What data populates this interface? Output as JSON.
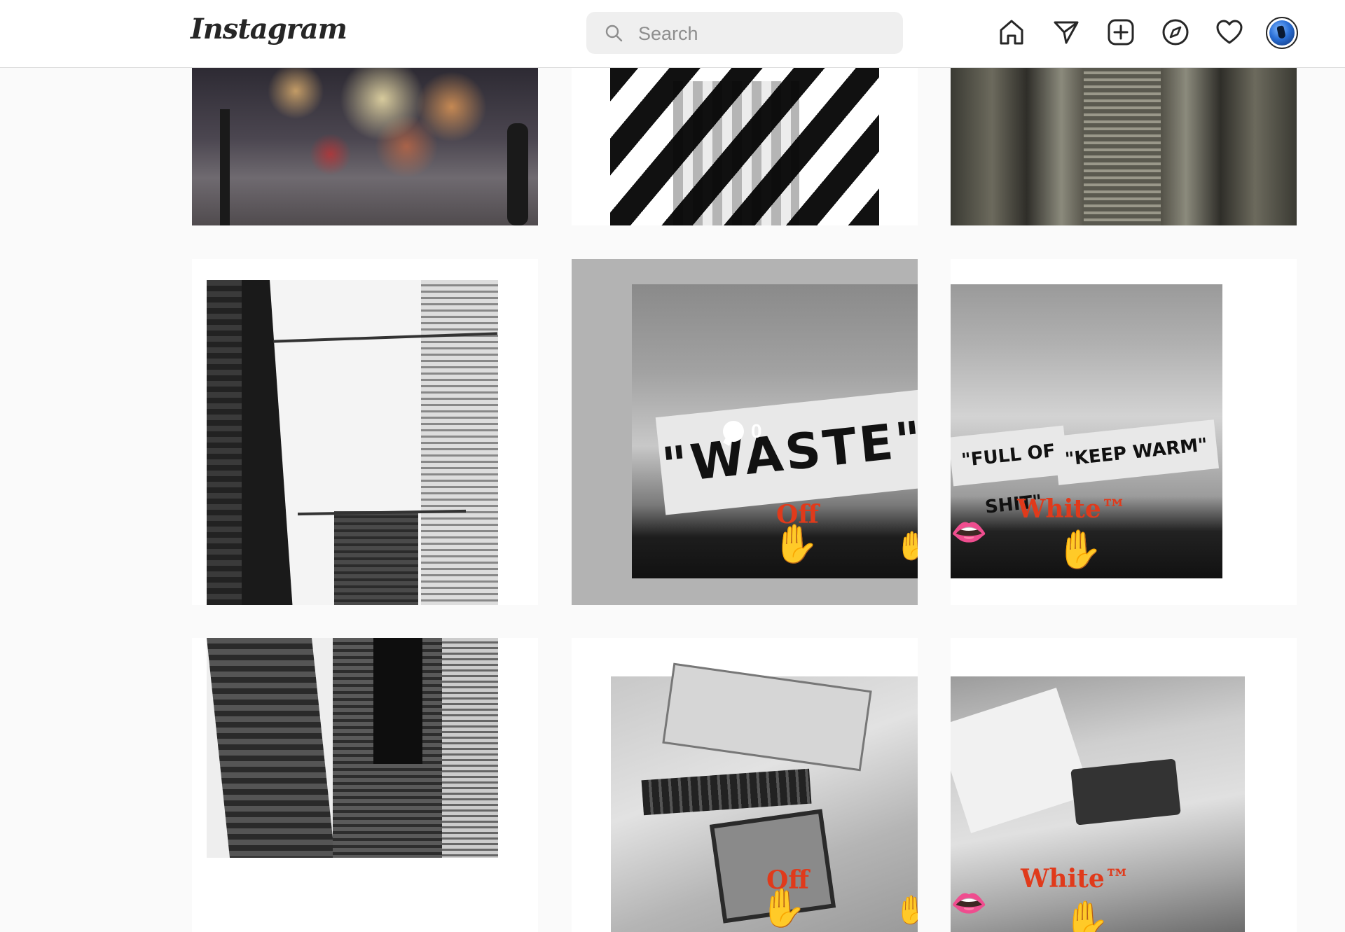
{
  "header": {
    "logo": "Instagram",
    "search_placeholder": "Search",
    "nav_icons": [
      "home-icon",
      "direct-icon",
      "new-post-icon",
      "explore-icon",
      "activity-icon",
      "avatar"
    ]
  },
  "grid": {
    "posts": [
      {
        "id": 1,
        "brand_left": "",
        "brand_right": ""
      },
      {
        "id": 2,
        "brand_left": "",
        "brand_right": ""
      },
      {
        "id": 3,
        "brand_left": "",
        "brand_right": ""
      },
      {
        "id": 4,
        "brand_left": "",
        "brand_right": ""
      },
      {
        "id": 5,
        "sign_text": "\"WASTE\"",
        "brand_text": "Off",
        "comments": "0"
      },
      {
        "id": 6,
        "sign_text_1": "\"FULL OF SHIT\"",
        "sign_text_2": "\"KEEP WARM\"",
        "brand_text": "White™"
      },
      {
        "id": 7,
        "brand_left": "",
        "brand_right": ""
      },
      {
        "id": 8,
        "brand_text": "Off"
      },
      {
        "id": 9,
        "brand_text": "White™"
      }
    ]
  },
  "colors": {
    "brand_red": "#e03a1b",
    "header_bg": "#ffffff",
    "page_bg": "#fafafa"
  }
}
